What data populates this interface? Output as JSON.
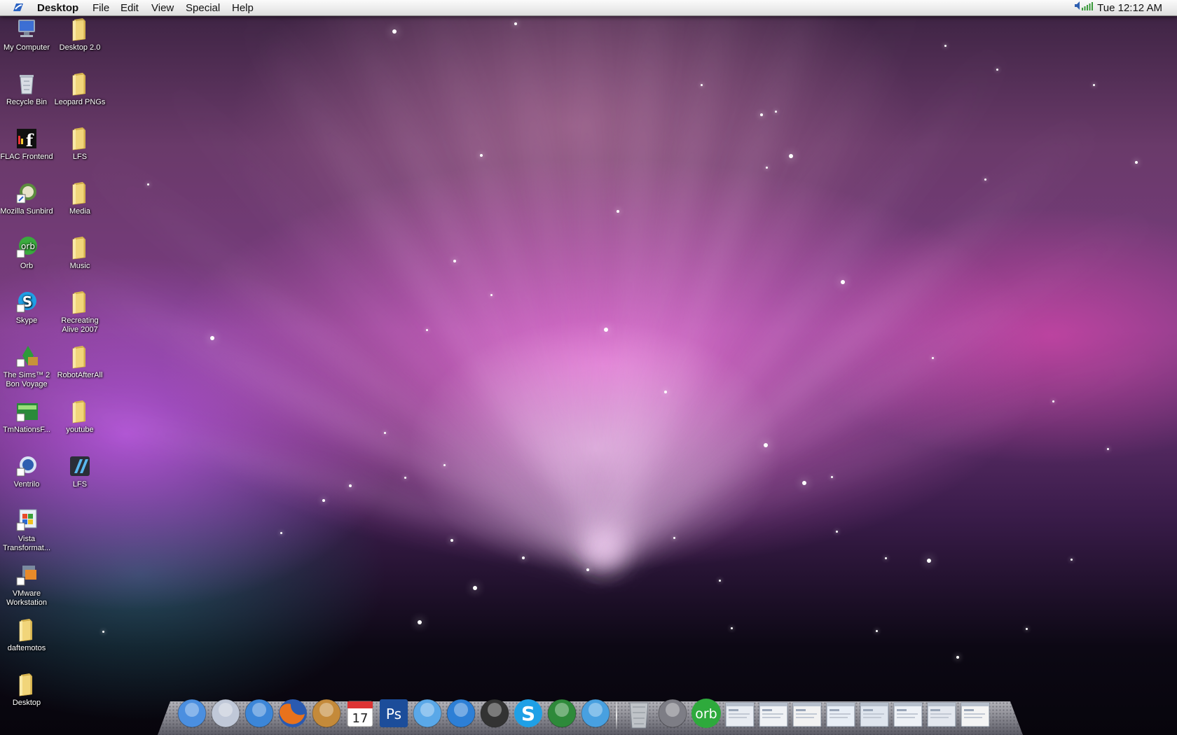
{
  "menubar": {
    "app_name": "Desktop",
    "menus": [
      "File",
      "Edit",
      "View",
      "Special",
      "Help"
    ],
    "clock": "Tue 12:12 AM"
  },
  "desktop": {
    "icons_left": [
      {
        "label": "My Computer",
        "icon": "computer-icon"
      },
      {
        "label": "Recycle Bin",
        "icon": "recycle-bin-icon"
      },
      {
        "label": "FLAC Frontend",
        "icon": "flac-icon"
      },
      {
        "label": "Mozilla Sunbird",
        "icon": "sunbird-icon"
      },
      {
        "label": "Orb",
        "icon": "orb-icon"
      },
      {
        "label": "Skype",
        "icon": "skype-icon"
      },
      {
        "label": "The Sims™ 2 Bon Voyage",
        "icon": "sims-icon"
      },
      {
        "label": "TmNationsF...",
        "icon": "tmnations-icon"
      },
      {
        "label": "Ventrilo",
        "icon": "ventrilo-icon"
      },
      {
        "label": "Vista Transformat...",
        "icon": "vista-transformation-icon"
      },
      {
        "label": "VMware Workstation",
        "icon": "vmware-icon"
      },
      {
        "label": "daftemotos",
        "icon": "folder-icon"
      },
      {
        "label": "Desktop",
        "icon": "folder-icon"
      }
    ],
    "icons_right": [
      {
        "label": "Desktop 2.0",
        "icon": "folder-icon"
      },
      {
        "label": "Leopard PNGs",
        "icon": "folder-icon"
      },
      {
        "label": "LFS",
        "icon": "folder-icon"
      },
      {
        "label": "Media",
        "icon": "folder-icon"
      },
      {
        "label": "Music",
        "icon": "folder-icon"
      },
      {
        "label": "Recreating Alive 2007",
        "icon": "folder-icon"
      },
      {
        "label": "RobotAfterAll",
        "icon": "folder-icon"
      },
      {
        "label": "youtube",
        "icon": "folder-icon"
      },
      {
        "label": "LFS",
        "icon": "lfs-app-icon"
      }
    ]
  },
  "dock": {
    "items": [
      {
        "name": "finder-icon",
        "color": "#4b8fe0"
      },
      {
        "name": "preview-icon",
        "color": "#c0c8d8"
      },
      {
        "name": "safari-icon",
        "color": "#3c86d8"
      },
      {
        "name": "firefox-icon",
        "color": "#e8721c"
      },
      {
        "name": "garageband-icon",
        "color": "#c48a3a"
      },
      {
        "name": "ical-icon",
        "color": "#ffffff"
      },
      {
        "name": "photoshop-icon",
        "color": "#1c4d9a"
      },
      {
        "name": "itunes-icon",
        "color": "#5aa8e8"
      },
      {
        "name": "quicktime-icon",
        "color": "#2d7fd6"
      },
      {
        "name": "lfs-icon",
        "color": "#333333"
      },
      {
        "name": "skype-icon",
        "color": "#1fa0e6"
      },
      {
        "name": "sims-icon",
        "color": "#2e8a3a"
      },
      {
        "name": "msn-messenger-icon",
        "color": "#48a0e0"
      },
      {
        "name": "trash-icon",
        "color": "#bfc3c8"
      },
      {
        "name": "system-preferences-icon",
        "color": "#7d7d85"
      },
      {
        "name": "orb-icon",
        "color": "#2eaa3c"
      },
      {
        "name": "window-thumbnail-icon",
        "color": "#e8ecf2"
      },
      {
        "name": "window-thumbnail-icon",
        "color": "#f0f2f5"
      },
      {
        "name": "window-thumbnail-icon",
        "color": "#f2f2f2"
      },
      {
        "name": "window-thumbnail-icon",
        "color": "#e8eef6"
      },
      {
        "name": "window-thumbnail-icon",
        "color": "#dfe5ee"
      },
      {
        "name": "window-thumbnail-icon",
        "color": "#eef1f6"
      },
      {
        "name": "window-thumbnail-icon",
        "color": "#e4e8ef"
      },
      {
        "name": "window-thumbnail-icon",
        "color": "#f4f4f4"
      }
    ]
  },
  "colors": {
    "menubar_text": "#111111",
    "folder": "#f1d57a",
    "icon_label": "#ffffff"
  }
}
